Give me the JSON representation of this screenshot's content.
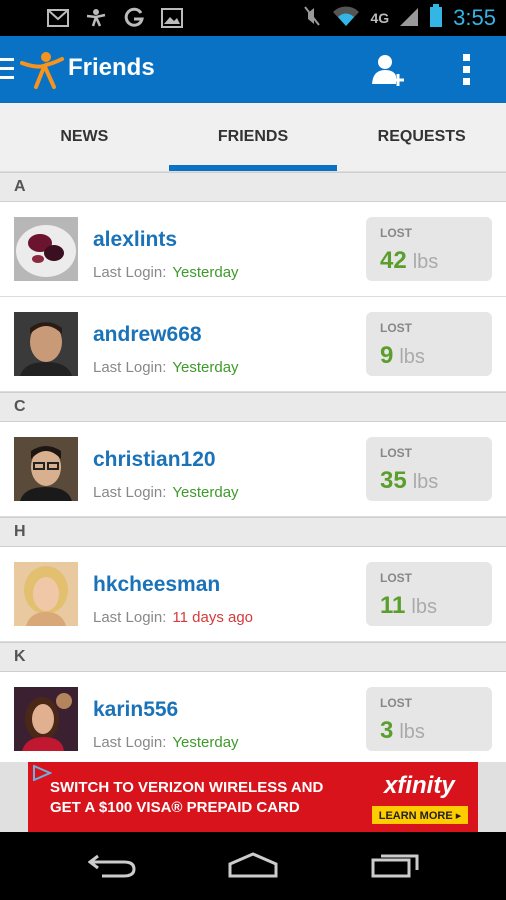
{
  "app": {
    "title": "Friends"
  },
  "status_bar": {
    "time": "3:55",
    "network": "4G"
  },
  "tabs": [
    {
      "label": "NEWS",
      "active": false
    },
    {
      "label": "FRIENDS",
      "active": true
    },
    {
      "label": "REQUESTS",
      "active": false
    }
  ],
  "labels": {
    "last_login": "Last Login:",
    "lost": "LOST",
    "unit": "lbs"
  },
  "sections": [
    {
      "letter": "A",
      "friends": [
        {
          "username": "alexlints",
          "last_login": "Yesterday",
          "recent": true,
          "lost": "42"
        },
        {
          "username": "andrew668",
          "last_login": "Yesterday",
          "recent": true,
          "lost": "9"
        }
      ]
    },
    {
      "letter": "C",
      "friends": [
        {
          "username": "christian120",
          "last_login": "Yesterday",
          "recent": true,
          "lost": "35"
        }
      ]
    },
    {
      "letter": "H",
      "friends": [
        {
          "username": "hkcheesman",
          "last_login": "11 days ago",
          "recent": false,
          "lost": "11"
        }
      ]
    },
    {
      "letter": "K",
      "friends": [
        {
          "username": "karin556",
          "last_login": "Yesterday",
          "recent": true,
          "lost": "3"
        }
      ]
    }
  ],
  "ad": {
    "line1": "SWITCH TO VERIZON WIRELESS AND",
    "line2": "GET A $100 VISA® PREPAID CARD",
    "brand": "xfinity",
    "cta": "LEARN MORE ▸"
  },
  "colors": {
    "primary": "#0a72c5",
    "green": "#3d9b2a",
    "red": "#d63a3a",
    "ad": "#d8131b"
  },
  "icons": [
    "gmail-icon",
    "sports-icon",
    "google-icon",
    "image-icon",
    "mute-icon",
    "wifi-icon",
    "signal-icon",
    "battery-icon",
    "menu-icon",
    "app-logo-icon",
    "add-friend-icon",
    "overflow-icon",
    "back-icon",
    "home-icon",
    "recent-apps-icon"
  ]
}
